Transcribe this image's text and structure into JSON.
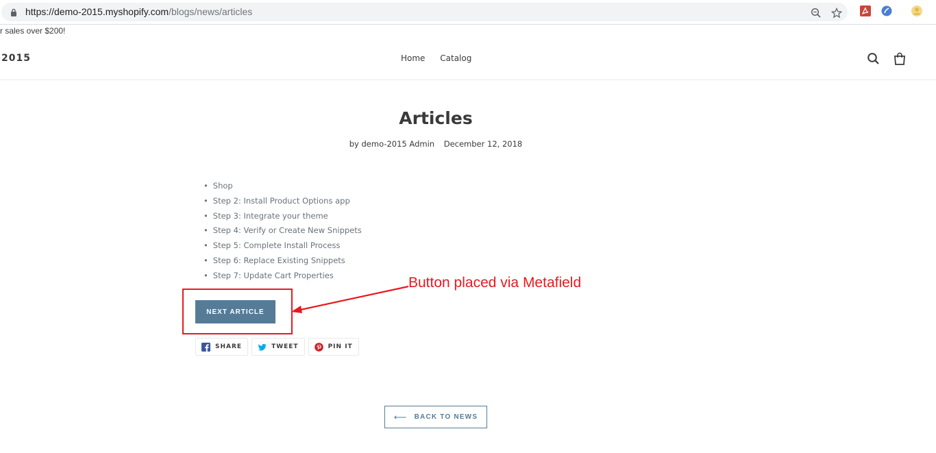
{
  "browser": {
    "url_host": "https://demo-2015.myshopify.com",
    "url_path": "/blogs/news/articles"
  },
  "announcement": {
    "text": "r sales over $200!"
  },
  "header": {
    "logo": "2015",
    "nav": [
      "Home",
      "Catalog"
    ]
  },
  "article": {
    "title": "Articles",
    "author": "by demo-2015 Admin",
    "date": "December 12, 2018",
    "steps": [
      "Shop",
      "Step 2: Install Product Options app",
      "Step 3: Integrate your theme",
      "Step 4: Verify or Create New Snippets",
      "Step 5: Complete Install Process",
      "Step 6: Replace Existing Snippets",
      "Step 7: Update Cart Properties"
    ],
    "next_button": "NEXT ARTICLE"
  },
  "annotation": {
    "text": "Button placed via Metafield"
  },
  "share": {
    "share": "SHARE",
    "tweet": "TWEET",
    "pin": "PIN IT"
  },
  "back": {
    "arrow": "⟵",
    "label": "BACK TO NEWS"
  },
  "colors": {
    "accent": "#557b97",
    "annotation_red": "#e8191e",
    "facebook": "#3b5998",
    "twitter": "#00aced",
    "pinterest": "#cb2027"
  }
}
